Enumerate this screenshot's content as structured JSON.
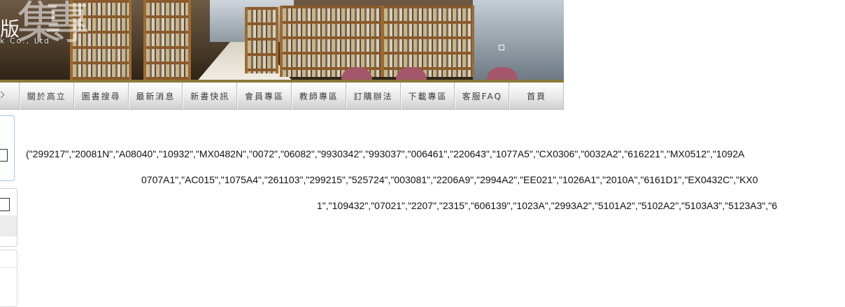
{
  "banner": {
    "logo_small": "版",
    "logo_big": "集",
    "logo_big2": "專",
    "logo_sub": "k Co., Ltd"
  },
  "nav": {
    "items": [
      {
        "label": "關於高立"
      },
      {
        "label": "圖書搜尋"
      },
      {
        "label": "最新消息"
      },
      {
        "label": "新書快訊"
      },
      {
        "label": "會員專區"
      },
      {
        "label": "教師專區"
      },
      {
        "label": "訂購辦法"
      },
      {
        "label": "下載專區"
      },
      {
        "label": "客服FAQ"
      },
      {
        "label": "首頁"
      }
    ]
  },
  "content": {
    "line1": "(\"299217\",\"20081N\",\"A08040\",\"10932\",\"MX0482N\",\"0072\",\"06082\",\"9930342\",\"993037\",\"006461\",\"220643\",\"1077A5\",\"CX0306\",\"0032A2\",\"616221\",\"MX0512\",\"1092A",
    "line2": "0707A1\",\"AC015\",\"1075A4\",\"261103\",\"299215\",\"525724\",\"003081\",\"2206A9\",\"2994A2\",\"EE021\",\"1026A1\",\"2010A\",\"6161D1\",\"EX0432C\",\"KX0",
    "line3": "1\",\"109432\",\"07021\",\"2207\",\"2315\",\"606139\",\"1023A\",\"2993A2\",\"5101A2\",\"5102A2\",\"5103A3\",\"5123A3\",\"6"
  }
}
